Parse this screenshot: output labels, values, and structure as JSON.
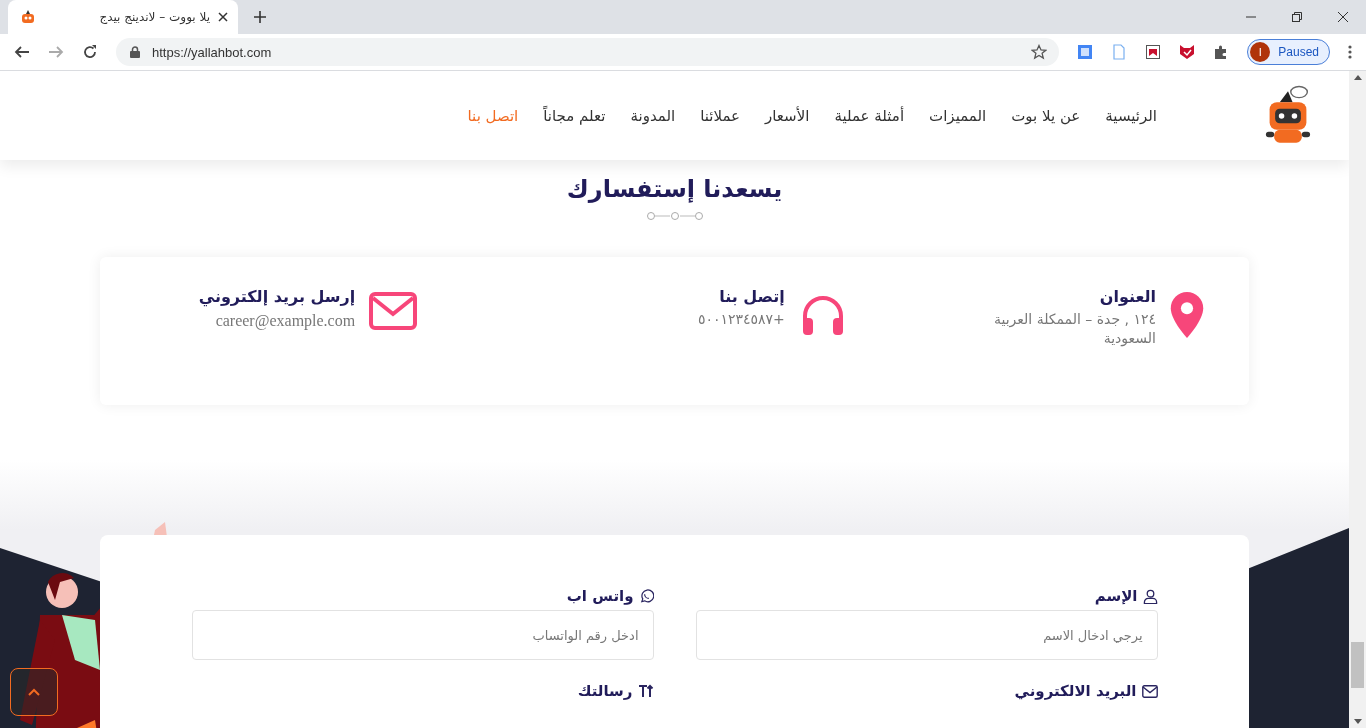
{
  "browser": {
    "tab_title": "يلا بووت – لاندينج بيدج",
    "url": "https://yallahbot.com",
    "profile_initial": "I",
    "profile_status": "Paused"
  },
  "nav": {
    "items": [
      {
        "label": "الرئيسية",
        "selected": false
      },
      {
        "label": "عن يلا بوت",
        "selected": false
      },
      {
        "label": "المميزات",
        "selected": false
      },
      {
        "label": "أمثلة عملية",
        "selected": false
      },
      {
        "label": "الأسعار",
        "selected": false
      },
      {
        "label": "عملائنا",
        "selected": false
      },
      {
        "label": "المدونة",
        "selected": false
      },
      {
        "label": "تعلم مجاناً",
        "selected": false
      },
      {
        "label": "اتصل بنا",
        "selected": true
      }
    ]
  },
  "section_title": "يسعدنا إستفسارك",
  "contact_items": [
    {
      "kind": "address",
      "title": "العنوان",
      "text": "١٢٤ , جدة – الممكلة العربية السعودية"
    },
    {
      "kind": "phone",
      "title": "إتصل بنا",
      "text": "+٥٠٠١٢٣٤٥٨٧"
    },
    {
      "kind": "email",
      "title": "إرسل بريد إلكتروني",
      "text": "career@example.com"
    }
  ],
  "form_fields": [
    {
      "kind": "name",
      "label": "الإسم",
      "placeholder": "يرجي ادخال الاسم"
    },
    {
      "kind": "whatsapp",
      "label": "واتس اب",
      "placeholder": "ادخل رقم الواتساب"
    },
    {
      "kind": "email",
      "label": "البريد الالكتروني"
    },
    {
      "kind": "message",
      "label": "رسالتك"
    }
  ]
}
